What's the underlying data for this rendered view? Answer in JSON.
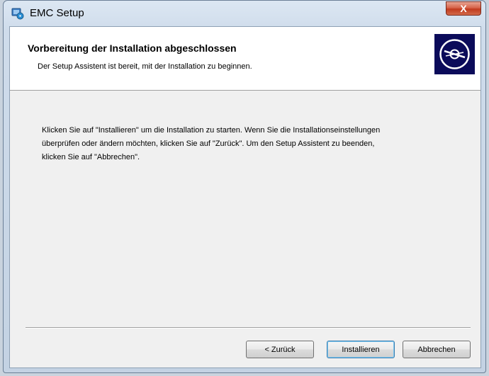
{
  "window": {
    "title": "EMC Setup",
    "close_label": "X"
  },
  "header": {
    "title": "Vorbereitung der Installation abgeschlossen",
    "subtitle": "Der Setup Assistent ist bereit, mit der Installation zu beginnen."
  },
  "body": {
    "line1": "Klicken Sie auf \"Installieren\" um die Installation zu starten. Wenn Sie die Installationseinstellungen",
    "line2": "überprüfen oder ändern möchten, klicken Sie auf \"Zurück\". Um den Setup Assistent zu beenden,",
    "line3": "klicken Sie auf \"Abbrechen\"."
  },
  "buttons": {
    "back": "< Zurück",
    "install": "Installieren",
    "cancel": "Abbrechen"
  },
  "icons": {
    "app": "installer-icon",
    "banner": "disc-icon",
    "close": "close-icon"
  }
}
